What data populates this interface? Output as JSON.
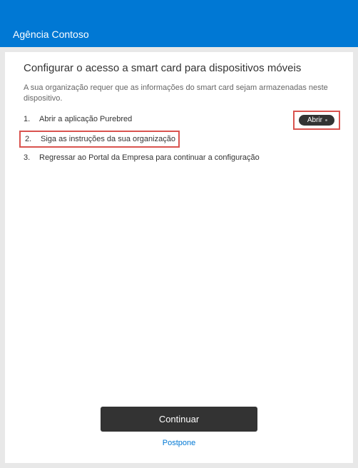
{
  "header": {
    "title": "Agência Contoso"
  },
  "main": {
    "title": "Configurar o acesso a smart card para dispositivos móveis",
    "description": "A sua organização requer que as informações do smart card sejam armazenadas neste dispositivo.",
    "steps": [
      {
        "num": "1.",
        "text": "Abrir a aplicação Purebred",
        "action_label": "Abrir"
      },
      {
        "num": "2.",
        "text": "Siga as instruções da sua organização"
      },
      {
        "num": "3.",
        "text": "Regressar ao Portal da Empresa para continuar a configuração"
      }
    ]
  },
  "footer": {
    "continue_label": "Continuar",
    "postpone_label": "Postpone"
  },
  "colors": {
    "accent": "#0078d4",
    "highlight": "#d9534f"
  }
}
